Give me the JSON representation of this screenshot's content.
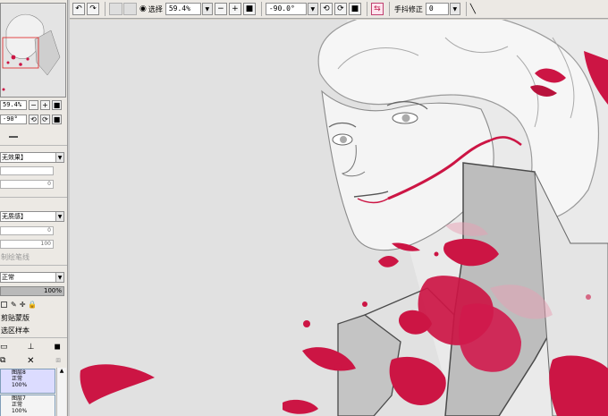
{
  "left_panel": {
    "zoom_value": "59.4%",
    "rotation_value": "-90°",
    "effect_dropdown": "无效果】",
    "effect_slider_value": "0",
    "texture_dropdown": "无质感】",
    "texture_slider_1": "0",
    "texture_slider_2": "100",
    "guide_label": "制绘笔线",
    "blend_mode_dropdown": "正常",
    "opacity_value": "100%",
    "clip_group_label": "剪贴蒙版",
    "select_source_label": "选区样本",
    "layers": [
      {
        "name": "图层8",
        "mode": "正常",
        "opacity": "100%"
      },
      {
        "name": "图层7",
        "mode": "正常",
        "opacity": "100%"
      }
    ]
  },
  "toolbar": {
    "selection_label": "选择",
    "zoom_value": "59.4%",
    "rotation_value": "-90.0°",
    "stabilizer_label": "手抖修正",
    "stabilizer_value": "0"
  },
  "colors": {
    "panel_bg": "#ece9e4",
    "canvas_bg": "#e1e1e1",
    "accent_red": "#cc1544",
    "layer_selected": "#dcdcff"
  }
}
